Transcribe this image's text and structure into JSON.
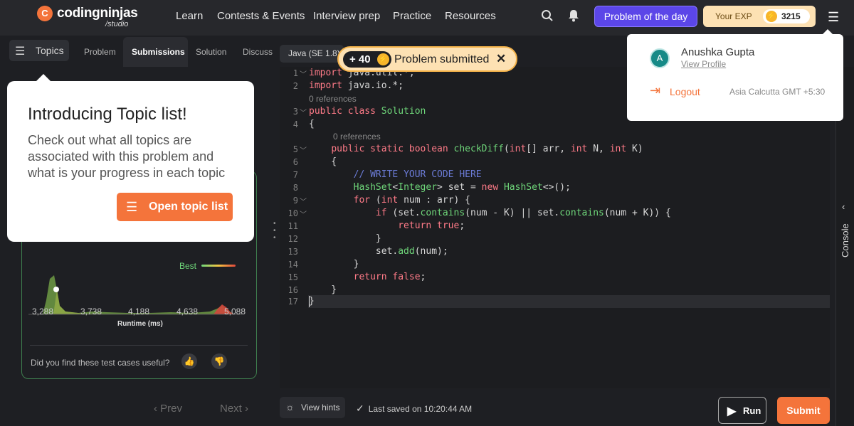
{
  "brand": {
    "logo_letter": "C",
    "name": "codingninjas",
    "sub": "/studio"
  },
  "nav": [
    "Learn",
    "Contests & Events",
    "Interview prep",
    "Practice",
    "Resources"
  ],
  "header": {
    "potd": "Problem of the day",
    "exp_label": "Your EXP",
    "exp_value": "3215"
  },
  "topics_label": "Topics",
  "tabs": [
    "Problem",
    "Submissions",
    "Solution",
    "Discuss"
  ],
  "language": "Java (SE 1.8)",
  "toast": {
    "points": "+ 40",
    "message": "Problem submitted"
  },
  "profile": {
    "initial": "A",
    "name": "Anushka Gupta",
    "view": "View Profile",
    "logout": "Logout",
    "timezone": "Asia Calcutta GMT +5:30"
  },
  "tip": {
    "title": "Introducing Topic list!",
    "body": "Check out what all topics are associated with this problem and what is your progress in each topic",
    "button": "Open topic list"
  },
  "chart": {
    "legend": "Best",
    "xlabel": "Runtime (ms)",
    "ticks": [
      "3,288",
      "3,738",
      "4,188",
      "4,638",
      "5,088"
    ]
  },
  "feedback": "Did you find these test cases useful?",
  "pager": {
    "prev": "Prev",
    "next": "Next"
  },
  "hints": "View hints",
  "saved": "Last saved on 10:20:44 AM",
  "run": "Run",
  "submit": "Submit",
  "console": "Console",
  "editor": {
    "refs": "0 references",
    "lines": [
      "1",
      "2",
      "3",
      "4",
      "5",
      "6",
      "7",
      "8",
      "9",
      "10",
      "11",
      "12",
      "13",
      "14",
      "15",
      "16",
      "17"
    ]
  },
  "colors": {
    "accent": "#f4743b",
    "potd": "#5b46e8",
    "exp_bg": "#fde1b3",
    "keyword": "#ff7b88",
    "type": "#6fd77a",
    "comment": "#6b7bd6"
  }
}
